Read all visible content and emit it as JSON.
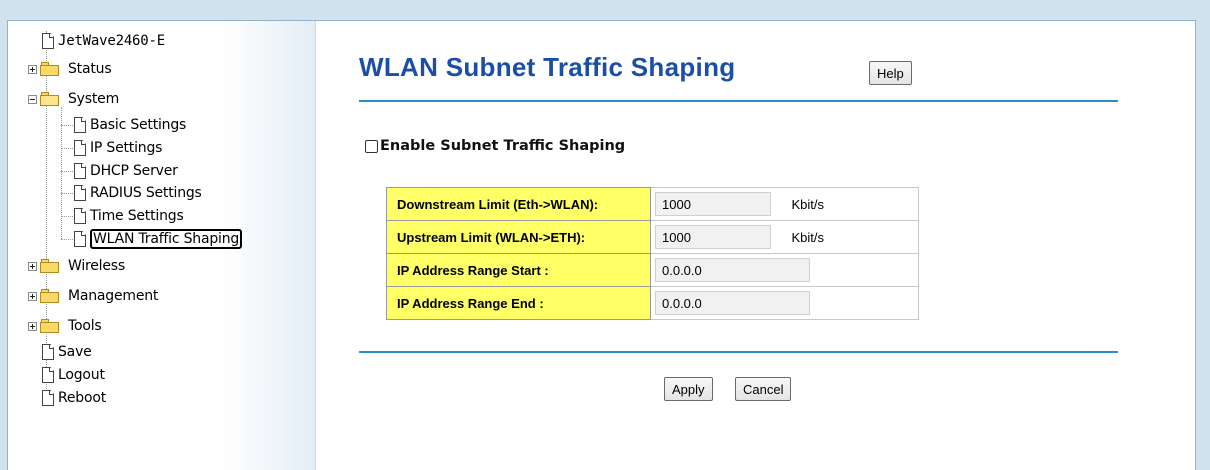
{
  "sidebar": {
    "root": "JetWave2460-E",
    "items": [
      {
        "label": "Status",
        "type": "folder",
        "expanded": false
      },
      {
        "label": "System",
        "type": "folder",
        "expanded": true,
        "children": [
          "Basic Settings",
          "IP Settings",
          "DHCP Server",
          "RADIUS Settings",
          "Time Settings",
          "WLAN Traffic Shaping"
        ]
      },
      {
        "label": "Wireless",
        "type": "folder",
        "expanded": false
      },
      {
        "label": "Management",
        "type": "folder",
        "expanded": false
      },
      {
        "label": "Tools",
        "type": "folder",
        "expanded": false
      },
      {
        "label": "Save",
        "type": "page"
      },
      {
        "label": "Logout",
        "type": "page"
      },
      {
        "label": "Reboot",
        "type": "page"
      }
    ],
    "selected": "WLAN Traffic Shaping"
  },
  "main": {
    "title": "WLAN Subnet Traffic Shaping",
    "help_label": "Help",
    "enable_label": "Enable Subnet Traffic Shaping",
    "enable_checked": false,
    "rows": [
      {
        "label": "Downstream Limit (Eth->WLAN):",
        "value": "1000",
        "unit": "Kbit/s"
      },
      {
        "label": "Upstream Limit (WLAN->ETH):",
        "value": "1000",
        "unit": "Kbit/s"
      },
      {
        "label": "IP Address Range Start :",
        "value": "0.0.0.0"
      },
      {
        "label": "IP Address Range End :",
        "value": "0.0.0.0"
      }
    ],
    "apply_label": "Apply",
    "cancel_label": "Cancel"
  },
  "colors": {
    "title": "#1b4fa6",
    "rule": "#2a8fc7",
    "label_bg": "#ffff66",
    "page_bg": "#cfe2ee"
  }
}
